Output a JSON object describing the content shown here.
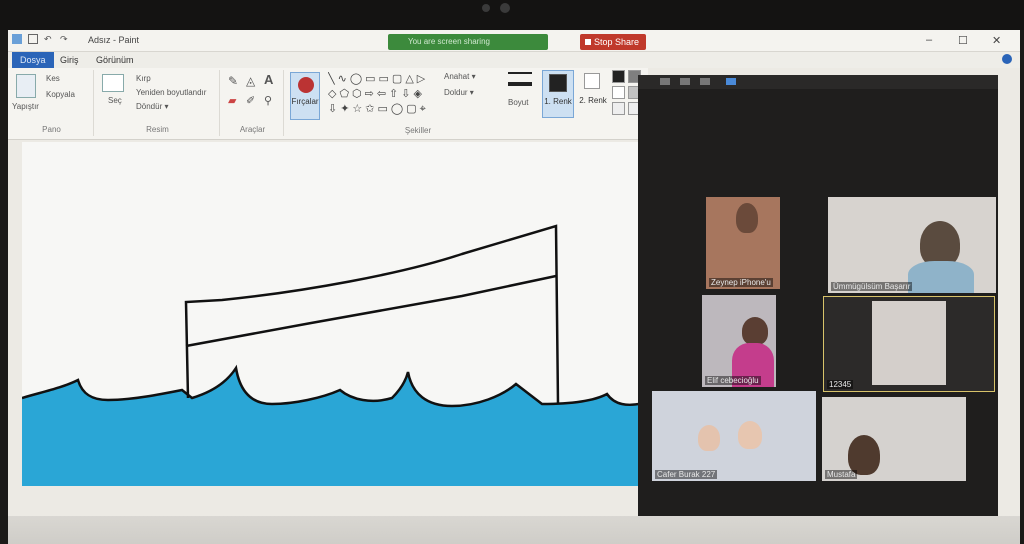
{
  "titlebar": {
    "app_title": "Adsız - Paint",
    "share_status": "You are screen sharing",
    "stop_share_label": "Stop Share",
    "minimize": "–",
    "maximize": "☐",
    "close": "✕"
  },
  "tabs": [
    {
      "label": "Dosya"
    },
    {
      "label": "Giriş"
    },
    {
      "label": "Görünüm"
    }
  ],
  "ribbon": {
    "pano": {
      "paste": "Yapıştır",
      "cut": "Kes",
      "copy": "Kopyala",
      "label": "Pano"
    },
    "resim": {
      "select": "Seç",
      "crop": "Kırp",
      "resize": "Yeniden boyutlandır",
      "rotate": "Döndür ▾",
      "label": "Resim"
    },
    "araclar": {
      "label": "Araçlar"
    },
    "brushes": {
      "label": "Fırçalar"
    },
    "sekiller": {
      "outline": "Anahat ▾",
      "fill": "Doldur ▾",
      "label": "Şekiller"
    },
    "size": {
      "label": "Boyut"
    },
    "color1": {
      "label": "1. Renk"
    },
    "color2": {
      "label": "2. Renk"
    }
  },
  "zoom_tiles": [
    {
      "name": "Zeynep iPhone'u"
    },
    {
      "name": "Ümmügülsüm Başarır"
    },
    {
      "name": "Elif cebecioğlu"
    },
    {
      "name": "12345"
    },
    {
      "name": "Cafer Burak 227"
    },
    {
      "name": "Mustafa"
    }
  ],
  "colors": {
    "sea": "#2aa6d6",
    "accent": "#2a64b8"
  }
}
